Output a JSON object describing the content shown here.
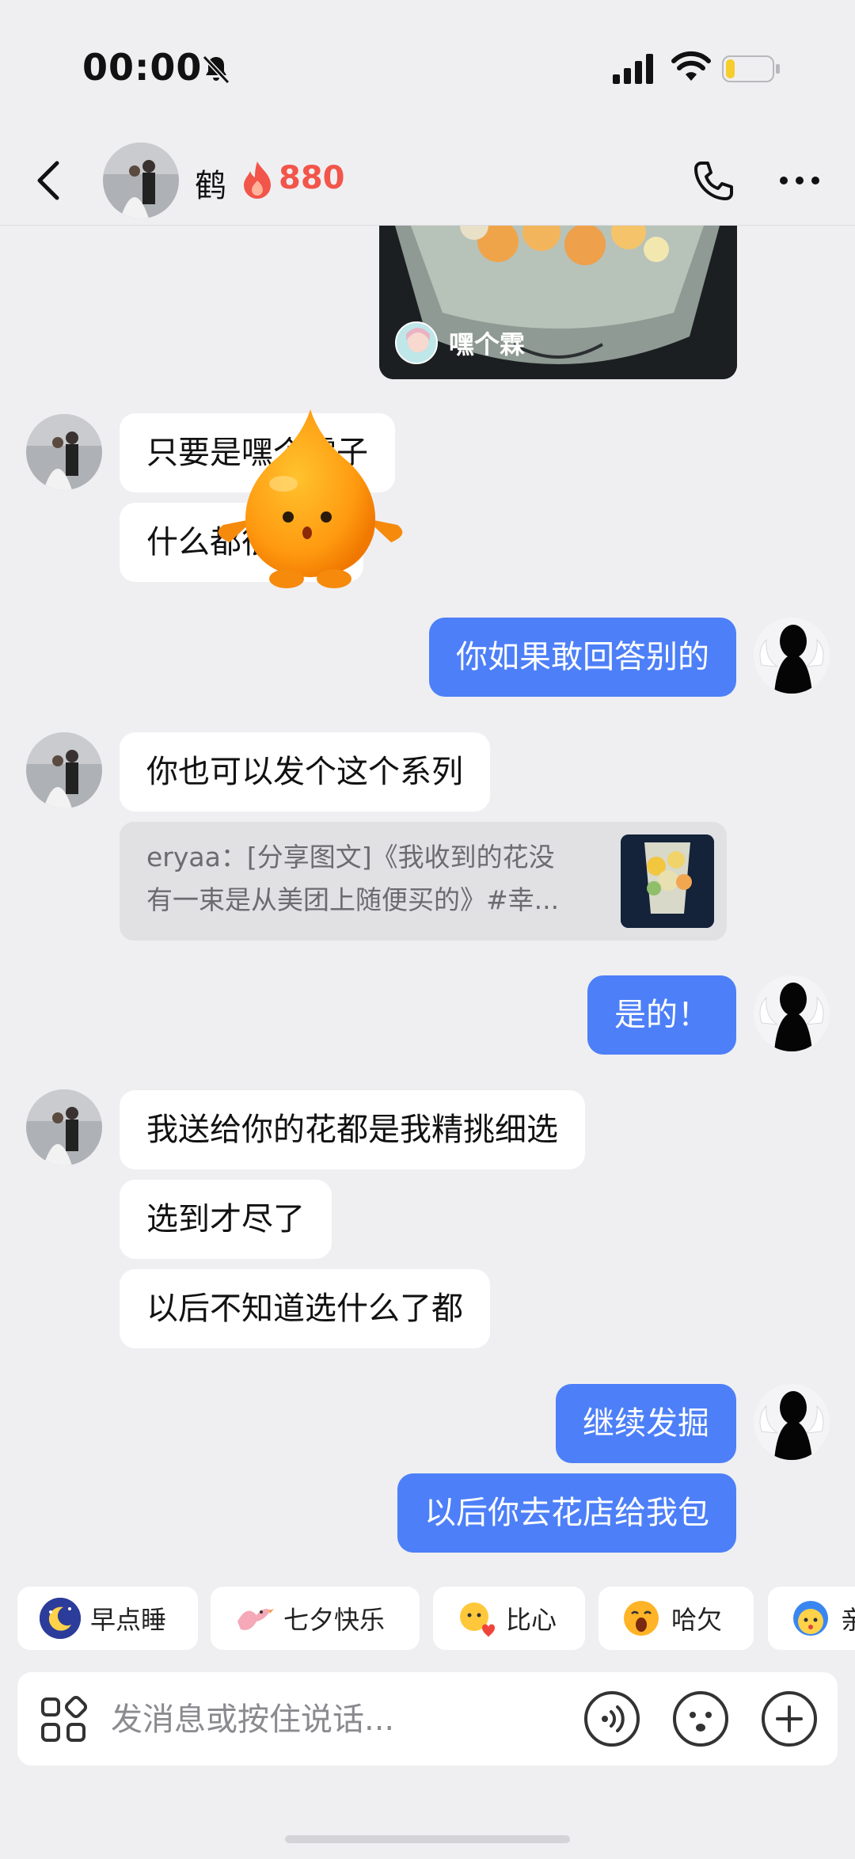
{
  "status_bar": {
    "time": "00:00",
    "battery_level": 0.2
  },
  "header": {
    "contact_name": "鹤",
    "streak_count": "880"
  },
  "chat": {
    "shared_card": {
      "sender_name": "嘿个霖"
    },
    "messages": [
      {
        "text": "只要是嘿个霖子"
      },
      {
        "text": "什么都很喜欢"
      },
      {
        "text": "你如果敢回答别的"
      },
      {
        "text": "你也可以发个这个系列"
      },
      {
        "text": "是的！"
      },
      {
        "text": "我送给你的花都是我精挑细选"
      },
      {
        "text": "选到才尽了"
      },
      {
        "text": "以后不知道选什么了都"
      },
      {
        "text": "继续发掘"
      },
      {
        "text": "以后你去花店给我包"
      }
    ],
    "quote": {
      "line1": "eryaa：[分享图文]《我收到的花没",
      "line2": "有一束是从美团上随便买的》#幸..."
    }
  },
  "quick_replies": [
    {
      "label": "早点睡",
      "icon": "moon-sleep-icon"
    },
    {
      "label": "七夕快乐",
      "icon": "bird-icon"
    },
    {
      "label": "比心",
      "icon": "heart-hands-icon"
    },
    {
      "label": "哈欠",
      "icon": "yawn-icon"
    },
    {
      "label": "亲",
      "icon": "kiss-icon"
    }
  ],
  "composer": {
    "placeholder": "发消息或按住说话..."
  },
  "colors": {
    "accent": "#4d7ff8",
    "streak": "#f2554a",
    "background": "#efeff1"
  }
}
